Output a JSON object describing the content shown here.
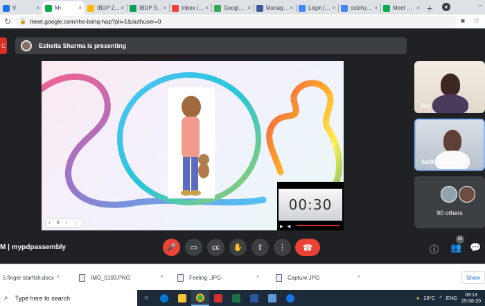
{
  "tabs": [
    {
      "label": "V",
      "color": "#1a73e8",
      "active": false
    },
    {
      "label": "M•",
      "color": "#00ac47",
      "active": true
    },
    {
      "label": "IBDP 2…",
      "color": "#fbbc04",
      "active": false
    },
    {
      "label": "IBDP S…",
      "color": "#0f9d58",
      "active": false
    },
    {
      "label": "Inbox (…",
      "color": "#ea4335",
      "active": false
    },
    {
      "label": "Googl…",
      "color": "#34a853",
      "active": false
    },
    {
      "label": "Manag…",
      "color": "#3c5a99",
      "active": false
    },
    {
      "label": "Login |…",
      "color": "#4285f4",
      "active": false
    },
    {
      "label": "catchy…",
      "color": "#4285f4",
      "active": false
    },
    {
      "label": "Meet …",
      "color": "#00ac47",
      "active": false
    }
  ],
  "browser": {
    "url": "meet.google.com/rhs-bohq-hap?pli=1&authuser=0"
  },
  "meet": {
    "presenter_text": "Esheita Sharma is presenting",
    "rec_label": "C",
    "meeting_name": "M  |  mypdpassembly",
    "timer": "00:30",
    "slide_page": "6",
    "participants": [
      {
        "name": "You"
      },
      {
        "name": "Adithya Rakesh"
      }
    ],
    "others_label": "90 others",
    "participant_count": "93"
  },
  "downloads": [
    {
      "name": "5 finger starfish.docx"
    },
    {
      "name": "IMG_0193.PNG"
    },
    {
      "name": "Feeling .JPG"
    },
    {
      "name": "Capture.JPG"
    }
  ],
  "show_all_label": "Show",
  "taskbar": {
    "search_placeholder": "Type here to search",
    "weather": "28°C",
    "lang": "ENG",
    "time": "09:13",
    "date": "25-08-20"
  }
}
